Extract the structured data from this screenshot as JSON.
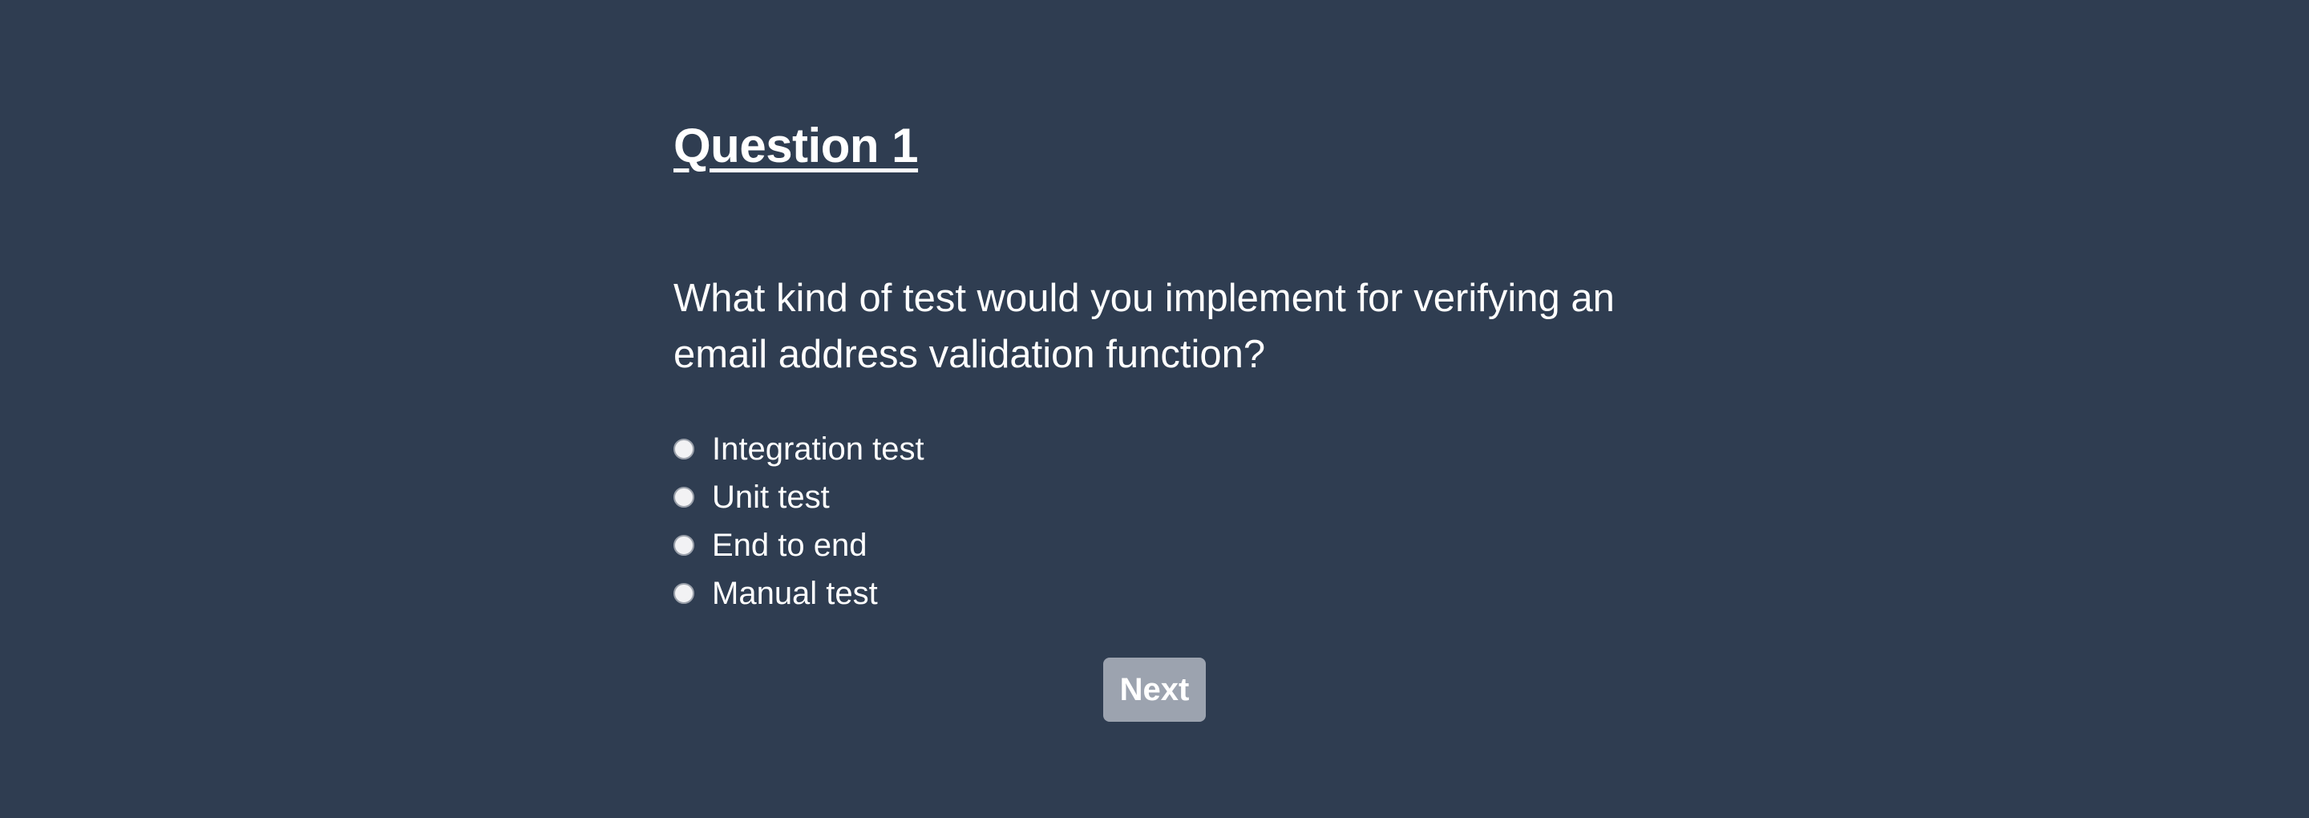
{
  "quiz": {
    "title": "Question 1",
    "question": "What kind of test would you implement for verifying an email address validation function?",
    "options": [
      {
        "label": "Integration test"
      },
      {
        "label": "Unit test"
      },
      {
        "label": "End to end"
      },
      {
        "label": "Manual test"
      }
    ],
    "next_label": "Next"
  },
  "colors": {
    "background": "#2f3d51",
    "text": "#ffffff",
    "button_background": "#9ca3af"
  }
}
